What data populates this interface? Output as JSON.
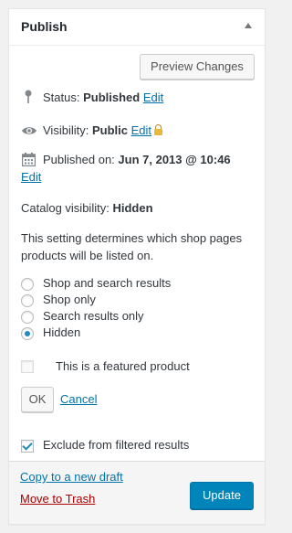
{
  "header": {
    "title": "Publish"
  },
  "preview_button": "Preview Changes",
  "status": {
    "label": "Status:",
    "value": "Published",
    "edit": "Edit"
  },
  "visibility": {
    "label": "Visibility:",
    "value": "Public",
    "edit": "Edit"
  },
  "published": {
    "label": "Published on:",
    "value": "Jun 7, 2013 @ 10:46",
    "edit": "Edit"
  },
  "catalog": {
    "label": "Catalog visibility:",
    "value": "Hidden",
    "description": "This setting determines which shop pages products will be listed on.",
    "options": [
      {
        "label": "Shop and search results",
        "selected": false
      },
      {
        "label": "Shop only",
        "selected": false
      },
      {
        "label": "Search results only",
        "selected": false
      },
      {
        "label": "Hidden",
        "selected": true
      }
    ],
    "featured_label": "This is a featured product",
    "ok": "OK",
    "cancel": "Cancel"
  },
  "exclude": {
    "label": "Exclude from filtered results",
    "checked": true
  },
  "footer": {
    "copy_draft": "Copy to a new draft",
    "trash": "Move to Trash",
    "update": "Update"
  },
  "colors": {
    "primary": "#0085ba",
    "link": "#0073aa",
    "trash": "#a00000"
  }
}
